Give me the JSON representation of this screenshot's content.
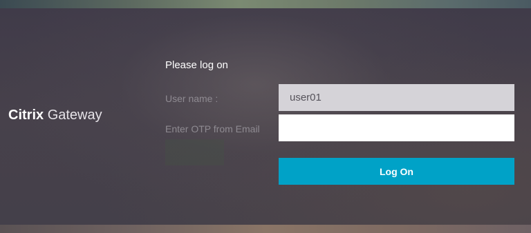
{
  "brand": {
    "product_bold": "Citrix",
    "product_light": "Gateway"
  },
  "form": {
    "prompt": "Please log on",
    "username_label": "User name :",
    "username_value": "user01",
    "otp_label": "Enter OTP from Email",
    "otp_value": "",
    "submit_label": "Log On"
  },
  "colors": {
    "background": "#3a3640",
    "button": "#00a2c7",
    "username_field_bg": "#d5d3d8",
    "otp_field_bg": "#ffffff",
    "label_text": "#8f8b92"
  }
}
